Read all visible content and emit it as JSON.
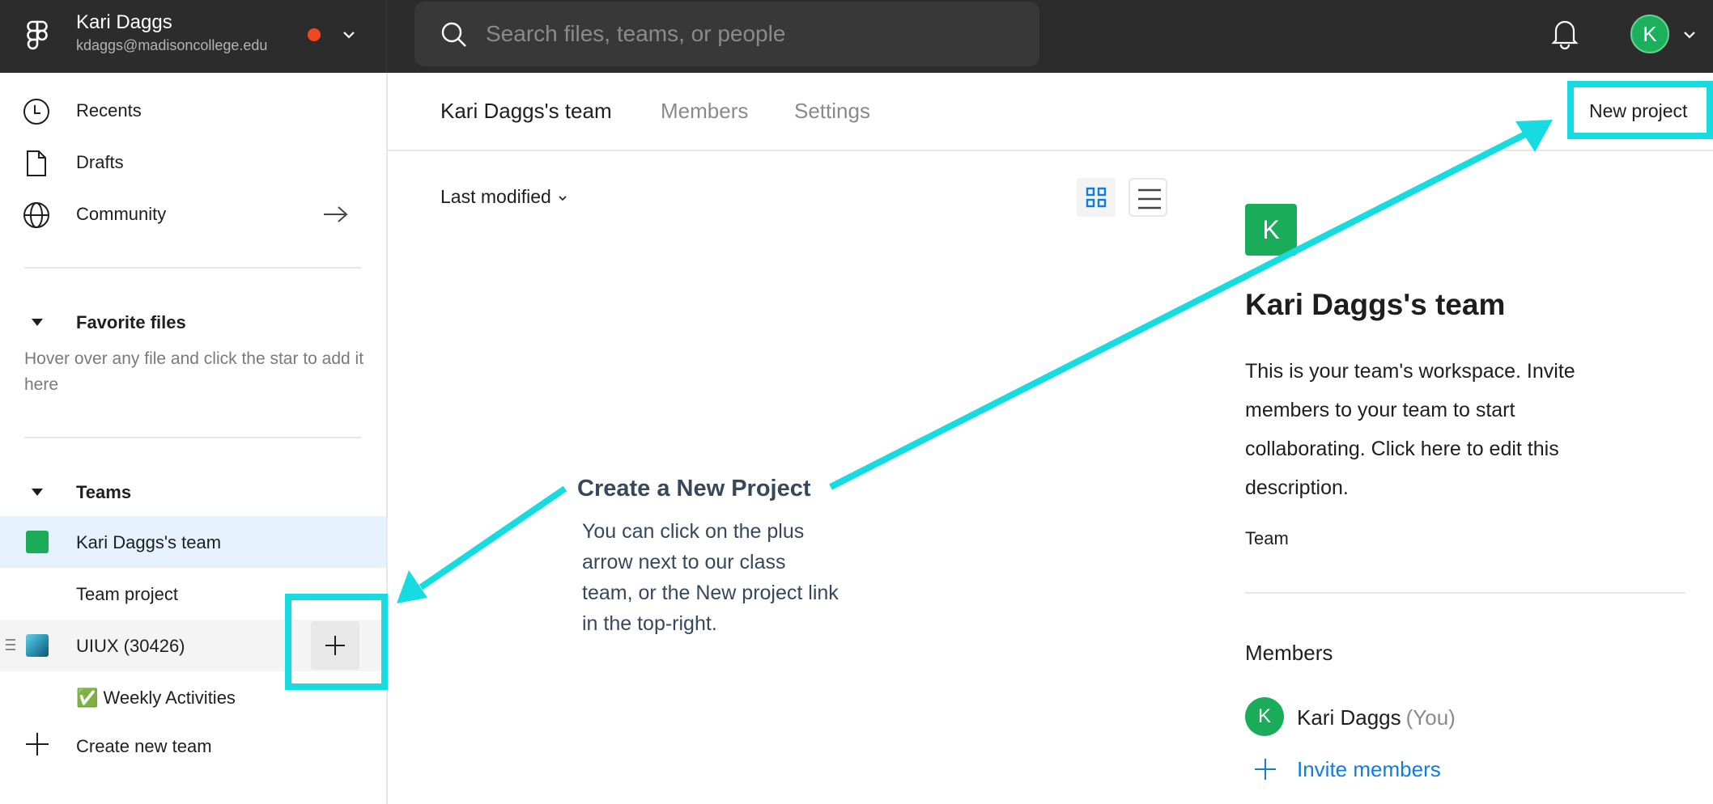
{
  "topbar": {
    "account_name": "Kari Daggs",
    "account_email": "kdaggs@madisoncollege.edu",
    "status_color": "#f24822",
    "search_placeholder": "Search files, teams, or people",
    "search_value": "",
    "avatar_initial": "K",
    "icons": [
      "figma-logo-icon",
      "chevron-down-icon",
      "search-icon",
      "bell-icon",
      "chevron-down-icon"
    ]
  },
  "sidebar": {
    "nav": [
      {
        "label": "Recents",
        "icon": "clock-icon"
      },
      {
        "label": "Drafts",
        "icon": "file-icon"
      },
      {
        "label": "Community",
        "icon": "globe-icon",
        "trailing_icon": "arrow-right-icon"
      }
    ],
    "favorites": {
      "heading": "Favorite files",
      "hint": "Hover over any file and click the star to add it here"
    },
    "teams": {
      "heading": "Teams",
      "items": [
        {
          "label": "Kari Daggs's team",
          "color": "#1bac5a",
          "selected": true
        },
        {
          "label": "Team project",
          "type": "project"
        },
        {
          "label": "UIUX (30426)",
          "type": "team",
          "hover": true,
          "action": "add-project-plus"
        },
        {
          "label": "✅ Weekly Activities",
          "type": "project"
        }
      ],
      "create_label": "Create new team"
    }
  },
  "main": {
    "tabs": [
      {
        "label": "Kari Daggs's team",
        "active": true
      },
      {
        "label": "Members",
        "active": false
      },
      {
        "label": "Settings",
        "active": false
      }
    ],
    "new_project_label": "New project",
    "sort_label": "Last modified",
    "view_mode": "grid",
    "accent_color": "#0d7de0"
  },
  "team_panel": {
    "avatar_initial": "K",
    "title": "Kari Daggs's team",
    "description": "This is your team's workspace. Invite members to your team to start collaborating. Click here to edit this description.",
    "type_label": "Team",
    "members_heading": "Members",
    "members": [
      {
        "initial": "K",
        "name": "Kari Daggs",
        "suffix": "(You)"
      }
    ],
    "invite_label": "Invite members"
  },
  "annotation": {
    "title": "Create a New Project",
    "body": "You can click on the plus arrow next to our class team, or the New project link in the top-right.",
    "highlight_color": "#16dce2"
  }
}
